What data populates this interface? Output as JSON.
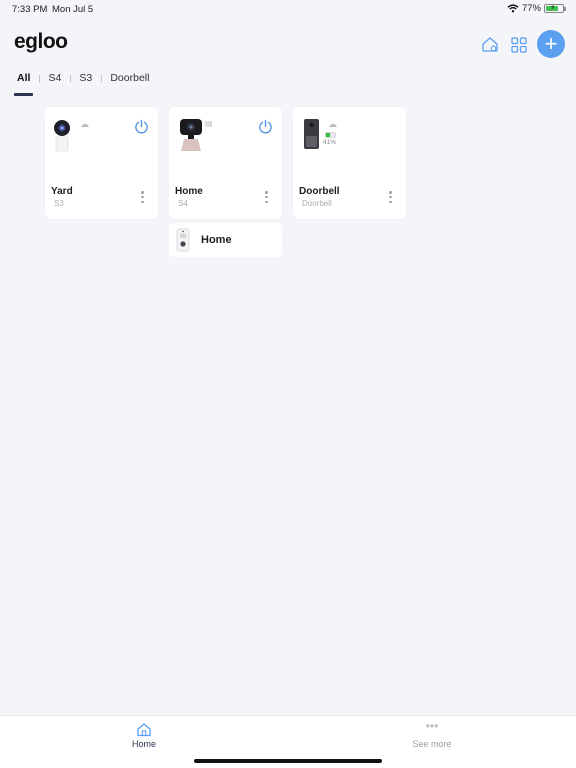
{
  "status": {
    "time": "7:33 PM",
    "date": "Mon Jul 5",
    "battery": "77%"
  },
  "header": {
    "logo": "egloo",
    "add_label": "+"
  },
  "tabs": [
    {
      "label": "All"
    },
    {
      "label": "S4"
    },
    {
      "label": "S3"
    },
    {
      "label": "Doorbell"
    }
  ],
  "devices": [
    {
      "name": "Yard",
      "model": "S3"
    },
    {
      "name": "Home",
      "model": "S4"
    },
    {
      "name": "Doorbell",
      "model": "Doorbell",
      "battery": "41%"
    }
  ],
  "group": {
    "name": "Home"
  },
  "bottom_nav": {
    "home": "Home",
    "more": "See more"
  },
  "colors": {
    "accent": "#5b9ff0",
    "power": "#4a90e2",
    "active_tab": "#2b3552"
  }
}
